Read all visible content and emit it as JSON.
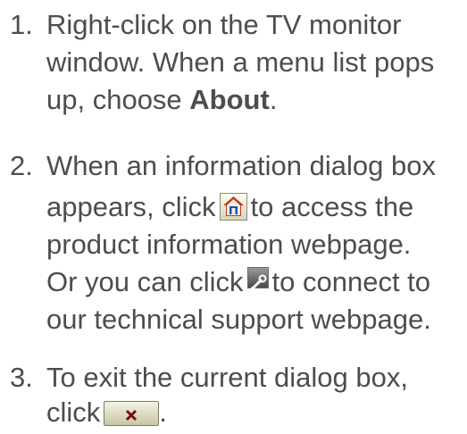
{
  "steps": [
    {
      "number": "1.",
      "line1": "Right-click on the TV monitor",
      "line2": "window. When a menu list pops",
      "line3_pre": "up, choose ",
      "line3_bold": "About",
      "line3_post": "."
    },
    {
      "number": "2.",
      "line1": "When an information dialog box",
      "line2_pre": "appears, click",
      "line2_post": "to access the",
      "line3": "product information webpage.",
      "line4_pre": "Or you can click",
      "line4_post": "to connect to",
      "line5": "our technical support webpage.",
      "icons": [
        "home-icon",
        "tools-icon"
      ]
    },
    {
      "number": "3.",
      "line1": "To exit the current dialog box,",
      "line2_pre": "click",
      "line2_post": ".",
      "icons": [
        "close-icon"
      ]
    }
  ],
  "colors": {
    "text": "#4d4d4d",
    "home_icon_roof": "#c0392b",
    "home_icon_house": "#1d4fb5",
    "close_icon_x": "#7a0f0f"
  }
}
